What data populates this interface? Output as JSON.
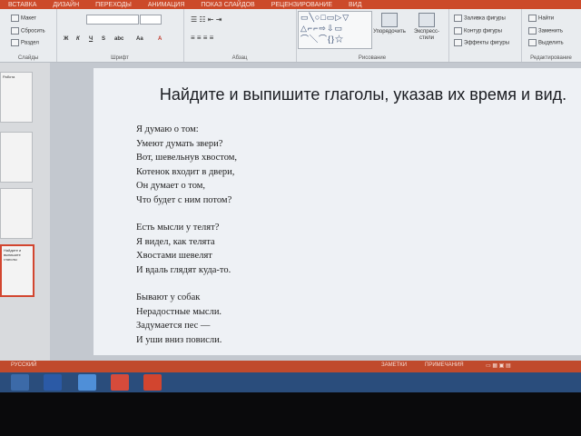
{
  "ribbon_tabs": [
    "ВСТАВКА",
    "ДИЗАЙН",
    "ПЕРЕХОДЫ",
    "АНИМАЦИЯ",
    "ПОКАЗ СЛАЙДОВ",
    "РЕЦЕНЗИРОВАНИЕ",
    "ВИД"
  ],
  "ribbon": {
    "slides_group": {
      "layout": "Макет",
      "reset": "Сбросить",
      "section": "Раздел",
      "label": "Слайды"
    },
    "font_group": {
      "label": "Шрифт"
    },
    "paragraph_group": {
      "label": "Абзац"
    },
    "drawing_group": {
      "arrange": "Упорядочить",
      "quick_styles": "Экспресс-стили",
      "fill": "Заливка фигуры",
      "outline": "Контур фигуры",
      "effects": "Эффекты фигуры",
      "label": "Рисование"
    },
    "editing_group": {
      "find": "Найти",
      "replace": "Заменить",
      "select": "Выделить",
      "label": "Редактирование"
    }
  },
  "slide": {
    "title": "Найдите и выпишите глаголы, указав их время и вид.",
    "stanzas": [
      [
        "Я думаю о том:",
        "Умеют думать звери?",
        "Вот, шевельнув хвостом,",
        "Котенок входит в двери,",
        "Он думает о том,",
        "Что будет с ним потом?"
      ],
      [
        "Есть мысли у телят?",
        "Я видел, как телята",
        "Хвостами шевелят",
        "И вдаль глядят куда-то."
      ],
      [
        "Бывают у собак",
        "Нерадостные мысли.",
        "Задумается пес —",
        "И уши вниз повисли."
      ]
    ]
  },
  "thumbnails": [
    "Работа",
    "",
    "",
    "Найдите и выпишите глаголы"
  ],
  "status": {
    "language": "РУССКИЙ",
    "notes": "ЗАМЕТКИ",
    "comments": "ПРИМЕЧАНИЯ"
  },
  "colors": {
    "accent": "#cc4a2a",
    "taskbar": "#2a4d7c"
  }
}
